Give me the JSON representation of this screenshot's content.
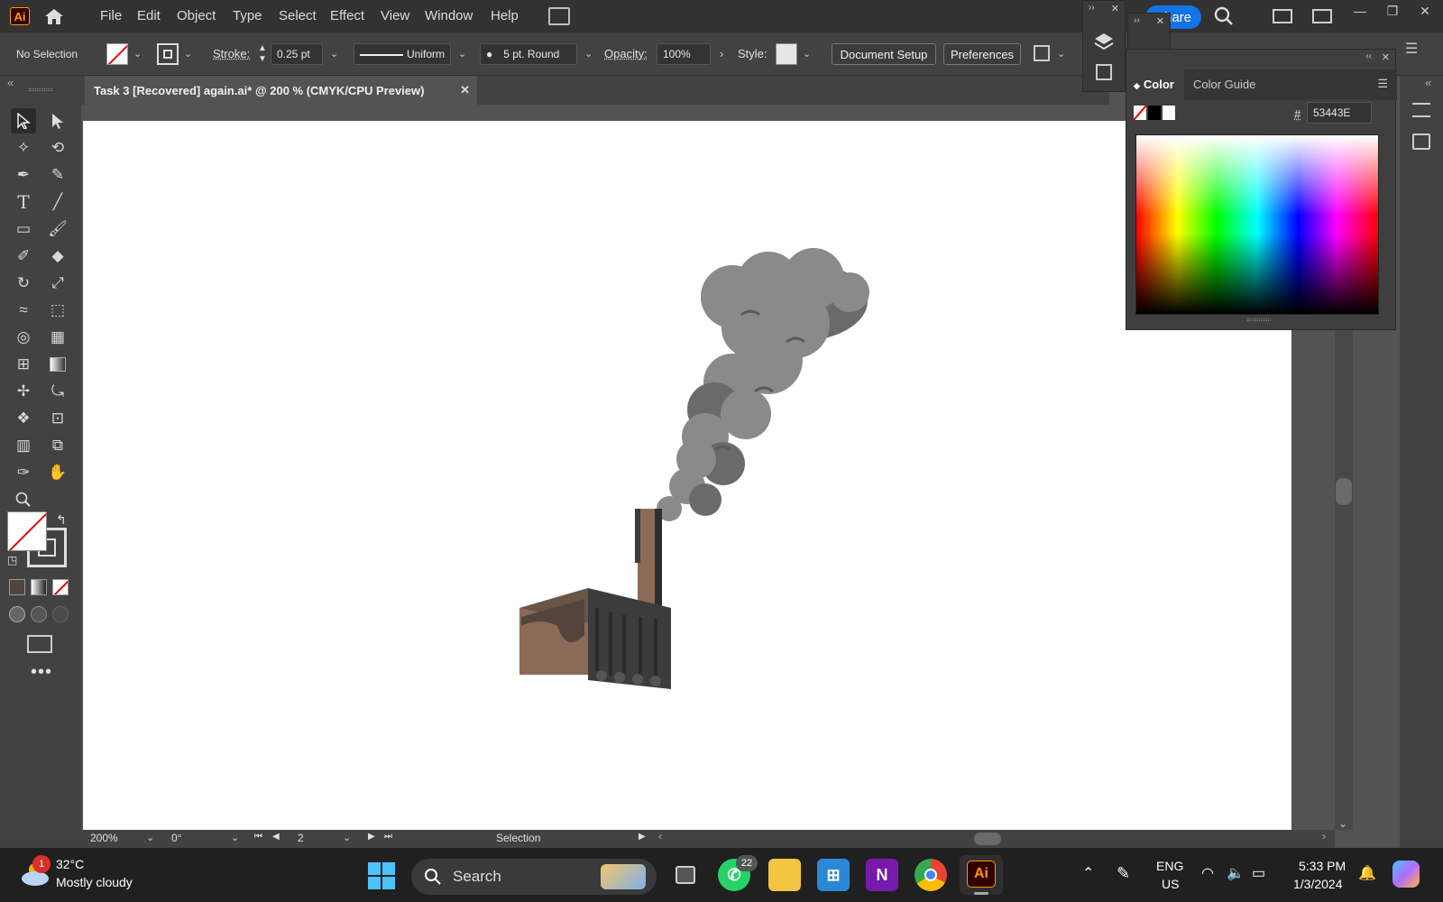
{
  "app": {
    "logo": "Ai",
    "home_icon": "home-icon"
  },
  "menu": [
    "File",
    "Edit",
    "Object",
    "Type",
    "Select",
    "Effect",
    "View",
    "Window",
    "Help"
  ],
  "share_label": "Share",
  "control": {
    "selection_status": "No Selection",
    "stroke_label": "Stroke:",
    "stroke_value": "0.25 pt",
    "stroke_profile": "Uniform",
    "brush": "5 pt. Round",
    "opacity_label": "Opacity:",
    "opacity_value": "100%",
    "style_label": "Style:",
    "document_setup": "Document Setup",
    "preferences": "Preferences"
  },
  "document": {
    "tab_title": "Task 3 [Recovered] again.ai* @ 200 % (CMYK/CPU Preview)"
  },
  "color_panel": {
    "tabs": [
      "Color",
      "Color Guide"
    ],
    "hex_label": "#",
    "hex_value": "53443E"
  },
  "status": {
    "zoom": "200%",
    "rotation": "0°",
    "artboard": "2",
    "tool": "Selection"
  },
  "artwork": {
    "smoke_color": "#8a8a8a",
    "smoke_shadow": "#6a6a6a",
    "building_color": "#8b6b58",
    "building_dark": "#3c3c3c"
  },
  "taskbar": {
    "weather_temp": "32°C",
    "weather_desc": "Mostly cloudy",
    "weather_badge": "1",
    "search_label": "Search",
    "whatsapp_badge": "22",
    "lang_top": "ENG",
    "lang_bottom": "US",
    "time": "5:33 PM",
    "date": "1/3/2024"
  }
}
